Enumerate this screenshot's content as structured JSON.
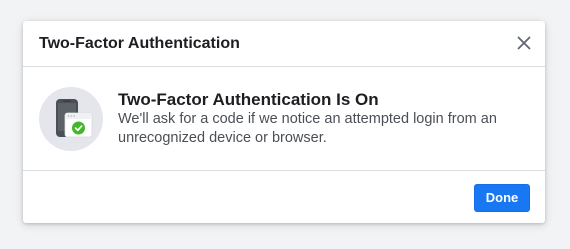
{
  "dialog": {
    "title": "Two-Factor Authentication",
    "close_icon": "close-icon"
  },
  "content": {
    "illustration_icon": "phone-browser-check-icon",
    "heading": "Two-Factor Authentication Is On",
    "description": "We'll ask for a code if we notice an attempted login from an unrecognized device or browser."
  },
  "footer": {
    "done_label": "Done"
  },
  "colors": {
    "accent": "#1877f2",
    "success": "#42b72a",
    "text_primary": "#1c1e21",
    "text_secondary": "#4b4f56",
    "divider": "#dadde1"
  }
}
